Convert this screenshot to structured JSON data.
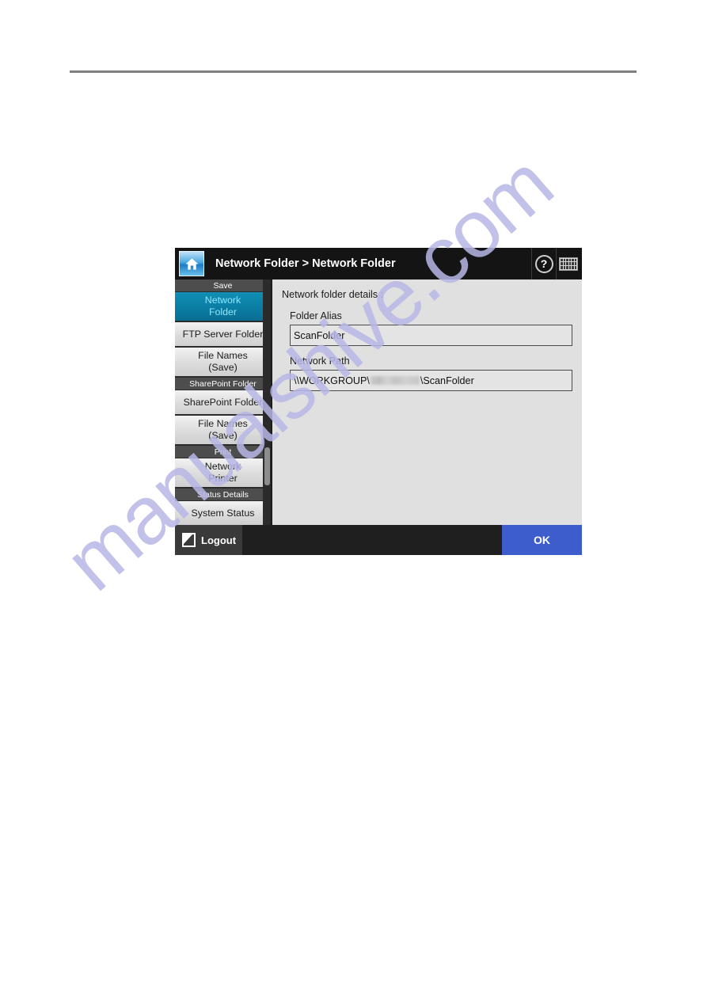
{
  "document": {
    "has_top_rule": true
  },
  "watermark": {
    "text": "manualshive.com",
    "color": "#b7b7e6"
  },
  "device": {
    "header": {
      "home_icon": "home-icon",
      "title": "Network Folder > Network Folder",
      "help_icon": "?",
      "help_icon_name": "help-icon",
      "keyboard_icon_name": "keyboard-icon"
    },
    "sidebar": {
      "sections": [
        {
          "header": "Save",
          "items": [
            {
              "label_line1": "Network",
              "label_line2": "Folder",
              "selected": true
            },
            {
              "label_line1": "FTP Server Folder",
              "label_line2": "",
              "selected": false
            },
            {
              "label_line1": "File Names",
              "label_line2": "(Save)",
              "selected": false
            }
          ]
        },
        {
          "header": "SharePoint Folder",
          "items": [
            {
              "label_line1": "SharePoint Folder",
              "label_line2": "",
              "selected": false
            },
            {
              "label_line1": "File Names",
              "label_line2": "(Save)",
              "selected": false
            }
          ]
        },
        {
          "header": "Print",
          "items": [
            {
              "label_line1": "Network",
              "label_line2": "Printer",
              "selected": false
            }
          ]
        },
        {
          "header": "Status Details",
          "items": [
            {
              "label_line1": "System Status",
              "label_line2": "",
              "selected": false
            }
          ]
        }
      ],
      "scrollbar": {
        "name": "sidebar-scrollbar"
      }
    },
    "content": {
      "title": "Network folder details :",
      "fields": [
        {
          "label": "Folder Alias",
          "value": "ScanFolder",
          "name": "folder-alias"
        },
        {
          "label": "Network Path",
          "value_prefix": "\\\\WORKGROUP\\",
          "value_redacted": true,
          "value_suffix": "\\ScanFolder",
          "name": "network-path"
        }
      ]
    },
    "footer": {
      "logout_label": "Logout",
      "ok_label": "OK"
    },
    "colors": {
      "accent_selected": "#0b7fa6",
      "ok_button": "#3d5dcc",
      "header_bar": "#141414",
      "content_bg": "#e0e0e0"
    }
  }
}
